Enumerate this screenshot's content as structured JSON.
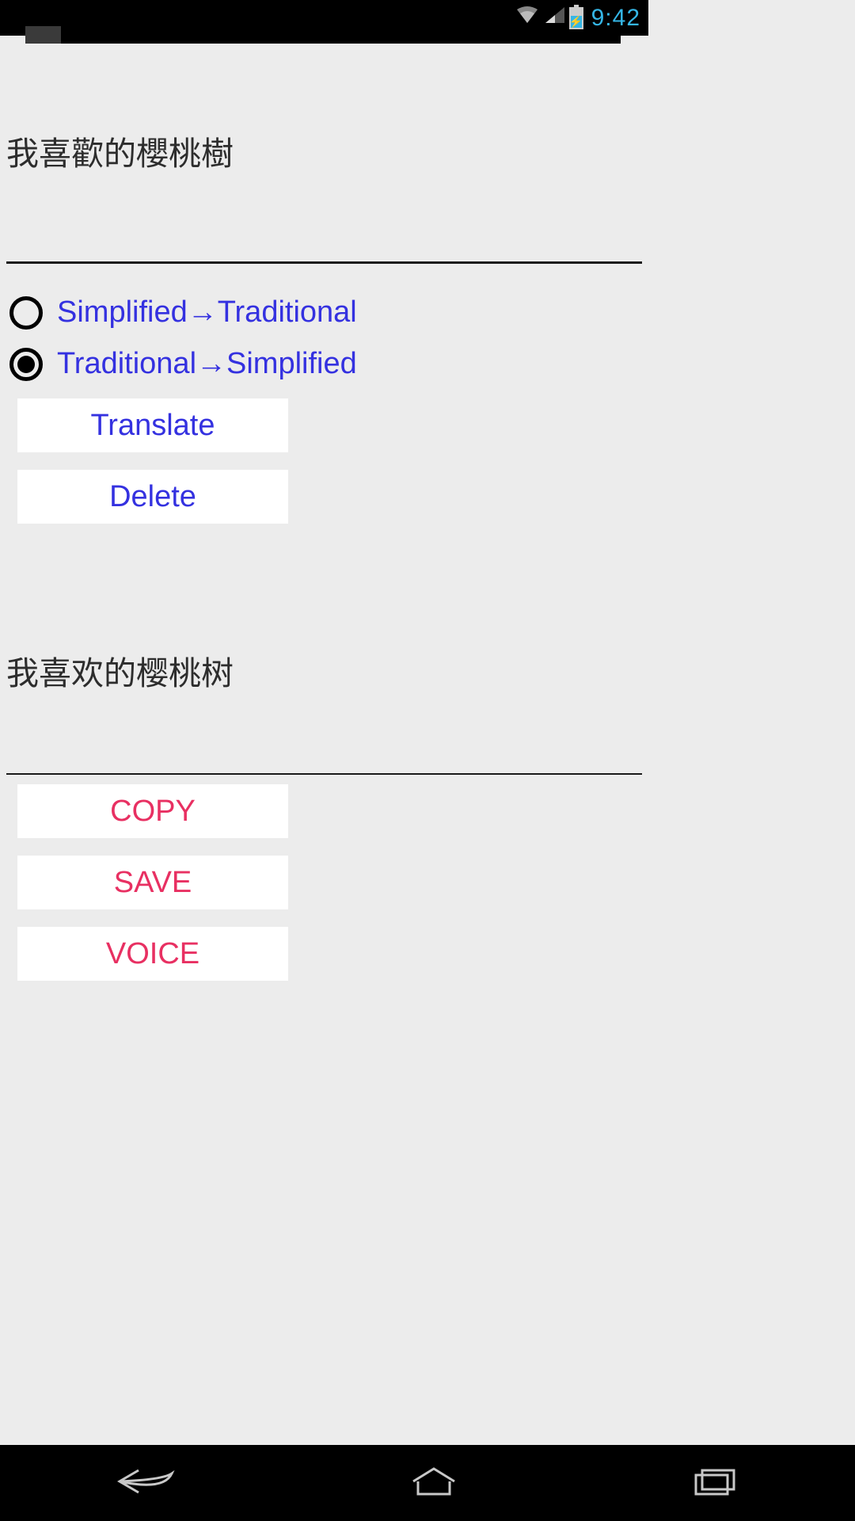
{
  "status": {
    "time": "9:42"
  },
  "input": {
    "text": "我喜歡的櫻桃樹"
  },
  "radios": {
    "simp_to_trad": "Simplified→Traditional",
    "trad_to_simp": "Traditional→Simplified",
    "selected": "trad_to_simp"
  },
  "buttons": {
    "translate": "Translate",
    "delete": "Delete",
    "copy": "COPY",
    "save": "SAVE",
    "voice": "VOICE"
  },
  "output": {
    "text": "我喜欢的樱桃树"
  }
}
